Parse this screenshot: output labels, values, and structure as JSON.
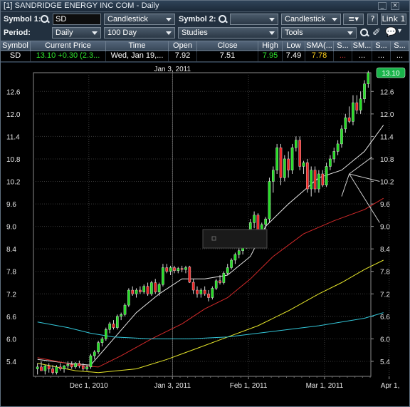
{
  "window": {
    "title": "[1] SANDRIDGE ENERGY INC   COM - Daily",
    "minimize_icon": "minimize-icon",
    "close_icon": "close-icon"
  },
  "toolbar": {
    "symbol1_label": "Symbol 1:",
    "symbol1_value": "SD",
    "chart_type_1": "Candlestick",
    "symbol2_label": "Symbol 2:",
    "symbol2_value": "",
    "chart_type_2": "Candlestick",
    "help_label": "?",
    "link_label": "Link 1",
    "period_label": "Period:",
    "period_value": "Daily",
    "range_value": "100 Day",
    "studies_label": "Studies",
    "tools_label": "Tools"
  },
  "quote_table": {
    "headers": [
      "Symbol",
      "Current Price",
      "Time",
      "Open",
      "Close",
      "High",
      "Low",
      "SMA(...",
      "S...",
      "SM...",
      "S...",
      "S..."
    ],
    "row": {
      "symbol": "SD",
      "current_price": "13.10  +0.30 (2.3...",
      "time": "Wed, Jan 19,...",
      "open": "7.92",
      "close": "7.51",
      "high": "7.95",
      "low": "7.49",
      "sma": "7.78",
      "s1": "...",
      "sm": "...",
      "s2": "...",
      "s3": "..."
    }
  },
  "colors": {
    "up_candle": "#22dd22",
    "down_candle": "#ee2222",
    "sma_white": "#e8e8e8",
    "sma_yellow": "#e6e62a",
    "sma_red": "#d42a2a",
    "sma_cyan": "#33c6d8",
    "last_price_badge": "#19b34a"
  },
  "chart_data": {
    "type": "candlestick",
    "crosshair_date_label": "Jan 3, 2011",
    "last_price_label": "13.10",
    "grid": true,
    "ylim": [
      5.0,
      13.1
    ],
    "y_ticks": [
      "5.4",
      "6.0",
      "6.6",
      "7.2",
      "7.8",
      "8.4",
      "9.0",
      "9.6",
      "10.2",
      "10.8",
      "11.4",
      "12.0",
      "12.6"
    ],
    "x_ticks": [
      "Dec 1, 2010",
      "Jan 3, 2011",
      "Feb 1, 2011",
      "Mar 1, 2011",
      "Apr 1,"
    ],
    "candles": [
      {
        "o": 5.2,
        "h": 5.35,
        "l": 5.05,
        "c": 5.25
      },
      {
        "o": 5.25,
        "h": 5.4,
        "l": 5.15,
        "c": 5.15
      },
      {
        "o": 5.15,
        "h": 5.3,
        "l": 5.05,
        "c": 5.28
      },
      {
        "o": 5.28,
        "h": 5.35,
        "l": 5.1,
        "c": 5.2
      },
      {
        "o": 5.2,
        "h": 5.3,
        "l": 5.05,
        "c": 5.1
      },
      {
        "o": 5.1,
        "h": 5.3,
        "l": 5.05,
        "c": 5.25
      },
      {
        "o": 5.25,
        "h": 5.35,
        "l": 5.15,
        "c": 5.2
      },
      {
        "o": 5.2,
        "h": 5.3,
        "l": 5.1,
        "c": 5.28
      },
      {
        "o": 5.28,
        "h": 5.4,
        "l": 5.2,
        "c": 5.32
      },
      {
        "o": 5.32,
        "h": 5.4,
        "l": 5.2,
        "c": 5.25
      },
      {
        "o": 5.25,
        "h": 5.38,
        "l": 5.2,
        "c": 5.35
      },
      {
        "o": 5.35,
        "h": 5.42,
        "l": 5.22,
        "c": 5.28
      },
      {
        "o": 5.28,
        "h": 5.35,
        "l": 5.15,
        "c": 5.2
      },
      {
        "o": 5.2,
        "h": 5.3,
        "l": 5.15,
        "c": 5.25
      },
      {
        "o": 5.25,
        "h": 5.6,
        "l": 5.2,
        "c": 5.55
      },
      {
        "o": 5.55,
        "h": 5.7,
        "l": 5.45,
        "c": 5.65
      },
      {
        "o": 5.65,
        "h": 5.95,
        "l": 5.6,
        "c": 5.9
      },
      {
        "o": 5.9,
        "h": 6.05,
        "l": 5.8,
        "c": 6.0
      },
      {
        "o": 6.0,
        "h": 6.3,
        "l": 5.95,
        "c": 6.25
      },
      {
        "o": 6.25,
        "h": 6.45,
        "l": 6.15,
        "c": 6.4
      },
      {
        "o": 6.4,
        "h": 6.5,
        "l": 6.25,
        "c": 6.3
      },
      {
        "o": 6.3,
        "h": 6.65,
        "l": 6.25,
        "c": 6.6
      },
      {
        "o": 6.6,
        "h": 6.7,
        "l": 6.5,
        "c": 6.65
      },
      {
        "o": 6.65,
        "h": 6.95,
        "l": 6.6,
        "c": 6.9
      },
      {
        "o": 6.9,
        "h": 7.35,
        "l": 6.85,
        "c": 7.3
      },
      {
        "o": 7.3,
        "h": 7.4,
        "l": 7.15,
        "c": 7.2
      },
      {
        "o": 7.2,
        "h": 7.35,
        "l": 7.1,
        "c": 7.3
      },
      {
        "o": 7.3,
        "h": 7.4,
        "l": 7.2,
        "c": 7.25
      },
      {
        "o": 7.25,
        "h": 7.45,
        "l": 7.2,
        "c": 7.4
      },
      {
        "o": 7.4,
        "h": 7.5,
        "l": 7.15,
        "c": 7.2
      },
      {
        "o": 7.2,
        "h": 7.55,
        "l": 7.15,
        "c": 7.5
      },
      {
        "o": 7.5,
        "h": 7.6,
        "l": 7.2,
        "c": 7.25
      },
      {
        "o": 7.25,
        "h": 7.5,
        "l": 7.15,
        "c": 7.45
      },
      {
        "o": 7.45,
        "h": 8.0,
        "l": 7.4,
        "c": 7.9
      },
      {
        "o": 7.9,
        "h": 8.0,
        "l": 7.75,
        "c": 7.8
      },
      {
        "o": 7.8,
        "h": 7.95,
        "l": 7.7,
        "c": 7.9
      },
      {
        "o": 7.9,
        "h": 7.95,
        "l": 7.75,
        "c": 7.82
      },
      {
        "o": 7.82,
        "h": 7.92,
        "l": 7.75,
        "c": 7.88
      },
      {
        "o": 7.88,
        "h": 7.95,
        "l": 7.78,
        "c": 7.85
      },
      {
        "o": 7.85,
        "h": 7.95,
        "l": 7.75,
        "c": 7.9
      },
      {
        "o": 7.92,
        "h": 7.95,
        "l": 7.49,
        "c": 7.51
      },
      {
        "o": 7.51,
        "h": 7.6,
        "l": 7.2,
        "c": 7.3
      },
      {
        "o": 7.3,
        "h": 7.4,
        "l": 7.1,
        "c": 7.2
      },
      {
        "o": 7.2,
        "h": 7.35,
        "l": 7.1,
        "c": 7.3
      },
      {
        "o": 7.3,
        "h": 7.4,
        "l": 7.15,
        "c": 7.2
      },
      {
        "o": 7.2,
        "h": 7.3,
        "l": 7.0,
        "c": 7.1
      },
      {
        "o": 7.1,
        "h": 7.4,
        "l": 7.05,
        "c": 7.35
      },
      {
        "o": 7.35,
        "h": 7.6,
        "l": 7.3,
        "c": 7.55
      },
      {
        "o": 7.55,
        "h": 7.7,
        "l": 7.45,
        "c": 7.5
      },
      {
        "o": 7.5,
        "h": 7.8,
        "l": 7.45,
        "c": 7.75
      },
      {
        "o": 7.75,
        "h": 8.0,
        "l": 7.7,
        "c": 7.9
      },
      {
        "o": 7.9,
        "h": 8.15,
        "l": 7.85,
        "c": 8.1
      },
      {
        "o": 8.1,
        "h": 8.3,
        "l": 8.0,
        "c": 8.25
      },
      {
        "o": 8.25,
        "h": 8.45,
        "l": 8.15,
        "c": 8.35
      },
      {
        "o": 8.35,
        "h": 8.5,
        "l": 8.25,
        "c": 8.45
      },
      {
        "o": 8.45,
        "h": 8.8,
        "l": 8.4,
        "c": 8.75
      },
      {
        "o": 8.75,
        "h": 9.2,
        "l": 8.7,
        "c": 9.1
      },
      {
        "o": 9.1,
        "h": 9.4,
        "l": 8.95,
        "c": 9.3
      },
      {
        "o": 9.3,
        "h": 9.35,
        "l": 8.6,
        "c": 8.7
      },
      {
        "o": 8.7,
        "h": 9.1,
        "l": 8.6,
        "c": 9.05
      },
      {
        "o": 9.05,
        "h": 9.25,
        "l": 8.9,
        "c": 9.2
      },
      {
        "o": 9.2,
        "h": 10.3,
        "l": 9.1,
        "c": 10.2
      },
      {
        "o": 10.2,
        "h": 10.6,
        "l": 9.9,
        "c": 10.5
      },
      {
        "o": 10.5,
        "h": 11.2,
        "l": 10.4,
        "c": 11.1
      },
      {
        "o": 11.1,
        "h": 11.2,
        "l": 10.1,
        "c": 10.3
      },
      {
        "o": 10.3,
        "h": 10.9,
        "l": 10.2,
        "c": 10.8
      },
      {
        "o": 10.8,
        "h": 11.0,
        "l": 10.3,
        "c": 10.5
      },
      {
        "o": 10.5,
        "h": 11.2,
        "l": 10.4,
        "c": 11.1
      },
      {
        "o": 11.1,
        "h": 11.4,
        "l": 11.0,
        "c": 11.3
      },
      {
        "o": 11.3,
        "h": 11.4,
        "l": 10.5,
        "c": 10.6
      },
      {
        "o": 10.6,
        "h": 10.75,
        "l": 10.4,
        "c": 10.7
      },
      {
        "o": 10.7,
        "h": 10.8,
        "l": 9.9,
        "c": 10.0
      },
      {
        "o": 10.0,
        "h": 10.6,
        "l": 9.8,
        "c": 10.5
      },
      {
        "o": 10.5,
        "h": 10.6,
        "l": 9.9,
        "c": 10.0
      },
      {
        "o": 10.0,
        "h": 10.5,
        "l": 9.9,
        "c": 10.4
      },
      {
        "o": 10.4,
        "h": 10.5,
        "l": 10.05,
        "c": 10.1
      },
      {
        "o": 10.1,
        "h": 10.7,
        "l": 10.05,
        "c": 10.6
      },
      {
        "o": 10.6,
        "h": 10.9,
        "l": 10.5,
        "c": 10.8
      },
      {
        "o": 10.8,
        "h": 11.1,
        "l": 10.7,
        "c": 11.0
      },
      {
        "o": 11.0,
        "h": 11.3,
        "l": 10.9,
        "c": 11.2
      },
      {
        "o": 11.2,
        "h": 11.7,
        "l": 11.1,
        "c": 11.6
      },
      {
        "o": 11.6,
        "h": 12.0,
        "l": 11.5,
        "c": 11.9
      },
      {
        "o": 11.9,
        "h": 12.2,
        "l": 11.75,
        "c": 11.8
      },
      {
        "o": 11.8,
        "h": 12.5,
        "l": 11.7,
        "c": 12.3
      },
      {
        "o": 12.3,
        "h": 12.5,
        "l": 12.0,
        "c": 12.1
      },
      {
        "o": 12.1,
        "h": 12.6,
        "l": 12.0,
        "c": 12.4
      },
      {
        "o": 12.4,
        "h": 12.9,
        "l": 12.3,
        "c": 12.8
      },
      {
        "o": 12.8,
        "h": 13.15,
        "l": 12.7,
        "c": 13.1
      }
    ],
    "series": [
      {
        "color": "#e8e8e8",
        "points": [
          [
            0,
            5.45
          ],
          [
            8,
            5.35
          ],
          [
            14,
            5.3
          ],
          [
            20,
            6.0
          ],
          [
            26,
            6.7
          ],
          [
            32,
            7.2
          ],
          [
            38,
            7.6
          ],
          [
            44,
            7.6
          ],
          [
            50,
            7.7
          ],
          [
            56,
            8.2
          ],
          [
            60,
            9.0
          ],
          [
            66,
            9.6
          ],
          [
            74,
            10.3
          ],
          [
            80,
            10.5
          ],
          [
            86,
            11.0
          ],
          [
            91,
            11.7
          ]
        ]
      },
      {
        "color": "#e6e62a",
        "points": [
          [
            0,
            5.35
          ],
          [
            10,
            5.15
          ],
          [
            16,
            5.1
          ],
          [
            26,
            5.2
          ],
          [
            34,
            5.45
          ],
          [
            42,
            5.75
          ],
          [
            50,
            6.05
          ],
          [
            58,
            6.35
          ],
          [
            66,
            6.75
          ],
          [
            74,
            7.2
          ],
          [
            80,
            7.5
          ],
          [
            86,
            7.85
          ],
          [
            91,
            8.1
          ]
        ]
      },
      {
        "color": "#d42a2a",
        "points": [
          [
            0,
            5.5
          ],
          [
            10,
            5.3
          ],
          [
            16,
            5.25
          ],
          [
            22,
            5.55
          ],
          [
            30,
            6.0
          ],
          [
            38,
            6.4
          ],
          [
            44,
            6.8
          ],
          [
            50,
            7.1
          ],
          [
            56,
            7.6
          ],
          [
            62,
            8.2
          ],
          [
            70,
            8.8
          ],
          [
            78,
            9.15
          ],
          [
            86,
            9.45
          ],
          [
            91,
            9.75
          ]
        ]
      },
      {
        "color": "#33c6d8",
        "points": [
          [
            0,
            6.45
          ],
          [
            8,
            6.3
          ],
          [
            14,
            6.15
          ],
          [
            20,
            6.05
          ],
          [
            30,
            6.0
          ],
          [
            40,
            6.0
          ],
          [
            50,
            6.05
          ],
          [
            58,
            6.15
          ],
          [
            66,
            6.25
          ],
          [
            74,
            6.35
          ],
          [
            80,
            6.45
          ],
          [
            86,
            6.55
          ],
          [
            91,
            6.7
          ]
        ]
      }
    ]
  }
}
